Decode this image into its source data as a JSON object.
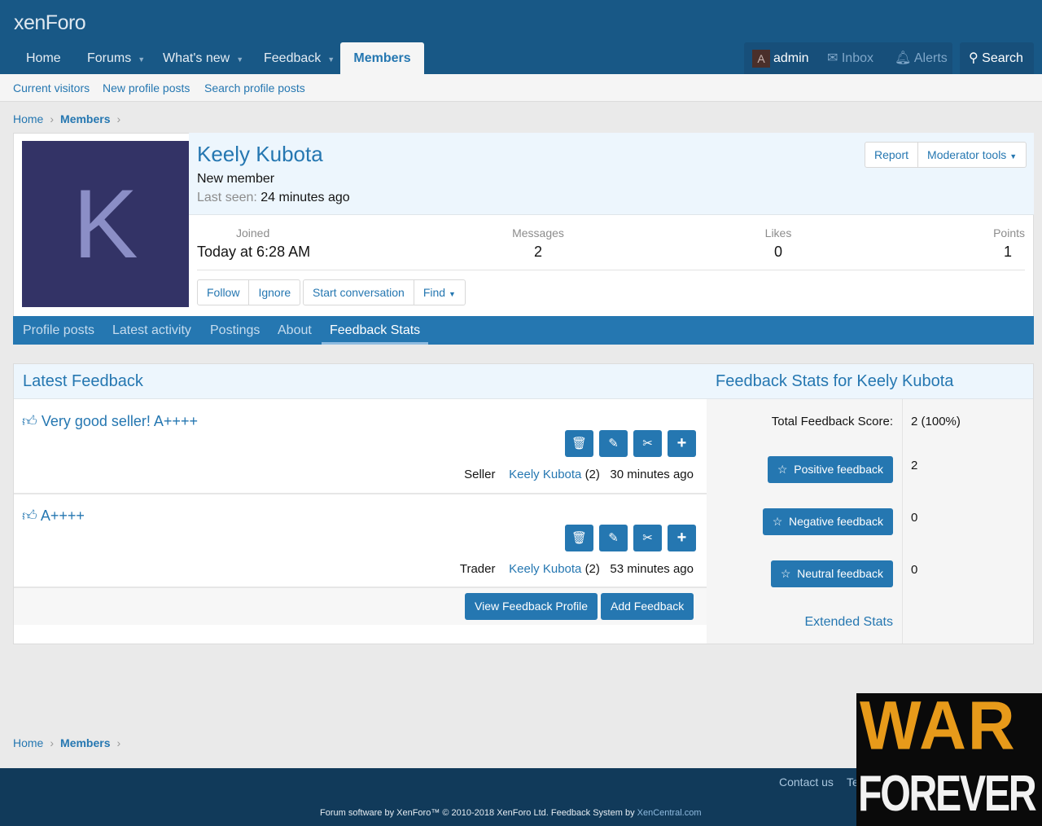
{
  "header": {
    "logo": "xenForo",
    "nav": [
      {
        "label": "Home"
      },
      {
        "label": "Forums"
      },
      {
        "label": "What's new"
      },
      {
        "label": "Feedback"
      },
      {
        "label": "Members"
      }
    ],
    "user": {
      "avatar_letter": "A",
      "name": "admin",
      "inbox": "Inbox",
      "alerts": "Alerts",
      "search": "Search"
    }
  },
  "subnav": [
    "Current visitors",
    "New profile posts",
    "Search profile posts"
  ],
  "breadcrumb": [
    "Home",
    "Members"
  ],
  "profile": {
    "avatar_letter": "K",
    "avatar_color": "#333366",
    "name": "Keely Kubota",
    "title": "New member",
    "last_seen_label": "Last seen:",
    "last_seen": "24 minutes ago",
    "stats": [
      {
        "label": "Joined",
        "value": "Today at 6:28 AM"
      },
      {
        "label": "Messages",
        "value": "2"
      },
      {
        "label": "Likes",
        "value": "0"
      },
      {
        "label": "Points",
        "value": "1"
      }
    ],
    "report": "Report",
    "moderator_tools": "Moderator tools",
    "actions": [
      "Follow",
      "Ignore",
      "Start conversation",
      "Find"
    ],
    "tabs": [
      "Profile posts",
      "Latest activity",
      "Postings",
      "About",
      "Feedback Stats"
    ]
  },
  "feedback": {
    "latest_title": "Latest Feedback",
    "stats_title": "Feedback Stats for Keely Kubota",
    "items": [
      {
        "text": "Very good seller! A++++",
        "role": "Seller",
        "user": "Keely Kubota",
        "count": "(2)",
        "time": "30 minutes ago"
      },
      {
        "text": "A++++",
        "role": "Trader",
        "user": "Keely Kubota",
        "count": "(2)",
        "time": "53 minutes ago"
      }
    ],
    "view_profile": "View Feedback Profile",
    "add": "Add Feedback",
    "total_label": "Total Feedback Score:",
    "total_value": "2 (100%)",
    "rows": [
      {
        "label": "Positive feedback",
        "value": "2"
      },
      {
        "label": "Negative feedback",
        "value": "0"
      },
      {
        "label": "Neutral feedback",
        "value": "0"
      }
    ],
    "extended": "Extended Stats"
  },
  "footer": {
    "contact": "Contact us",
    "terms": "Te",
    "copyright": "Forum software by XenForo™ © 2010-2018 XenForo Ltd. Feedback System by ",
    "credit_link": "XenCentral.com"
  },
  "watermark": {
    "line1": "WAR",
    "line2": "FOREVER"
  },
  "colors": {
    "header": "#185886",
    "accent": "#2577b1",
    "footer": "#113a5a"
  }
}
